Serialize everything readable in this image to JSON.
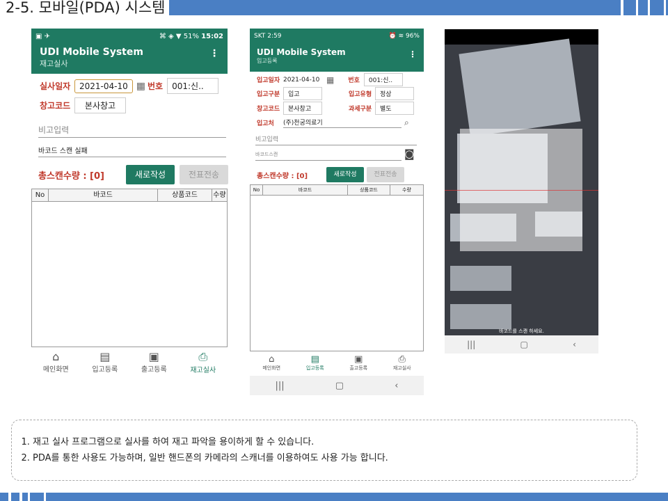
{
  "page": {
    "title": "2-5. 모바일(PDA) 시스템"
  },
  "phone1": {
    "status": {
      "battery": "51%",
      "time": "15:02"
    },
    "app_title": "UDI Mobile System",
    "app_subtitle": "재고실사",
    "date_label": "실사일자",
    "date_value": "2021-04-10",
    "number_label": "번호",
    "number_value": "001:신..",
    "warehouse_label": "창고코드",
    "warehouse_value": "본사창고",
    "remark_placeholder": "비고입력",
    "barcode_status": "바코드 스캔 실패",
    "total_label": "총스캔수량 : [0]",
    "new_button": "새로작성",
    "send_button": "전표전송",
    "columns": [
      "No",
      "바코드",
      "상품코드",
      "수량"
    ],
    "nav": [
      "메인화면",
      "입고등록",
      "출고등록",
      "재고실사"
    ]
  },
  "phone2": {
    "status": {
      "carrier": "SKT 2:59",
      "battery": "96%"
    },
    "app_title": "UDI Mobile System",
    "app_subtitle": "입고등록",
    "date_label": "입고일자",
    "date_value": "2021-04-10",
    "number_label": "번호",
    "number_value": "001:신..",
    "type_label": "입고구분",
    "type_value": "입고",
    "kind_label": "입고유형",
    "kind_value": "정상",
    "warehouse_label": "창고코드",
    "warehouse_value": "본사창고",
    "tax_label": "과세구분",
    "tax_value": "별도",
    "supplier_label": "입고처",
    "supplier_value": "(주)천궁의료기",
    "remark_placeholder": "비고입력",
    "barcode_placeholder": "바코드스캔",
    "total_label": "총스캔수량 : [0]",
    "new_button": "새로작성",
    "send_button": "전표전송",
    "columns": [
      "No",
      "바코드",
      "상품코드",
      "수량"
    ],
    "nav": [
      "메인화면",
      "입고등록",
      "출고등록",
      "재고실사"
    ]
  },
  "photo": {
    "caption": "바코드를 스캔 하세요."
  },
  "notes": [
    "재고 실사 프로그램으로 실사를 하여 재고 파악을 용이하게 할 수 있습니다.",
    "PDA를 통한 사용도 가능하며, 일반 핸드폰의 카메라의 스캐너를 이용하여도 사용 가능 합니다."
  ],
  "colors": {
    "accent": "#1f7a62",
    "brand_blue": "#4a7fc4",
    "label_red": "#c0392b"
  }
}
